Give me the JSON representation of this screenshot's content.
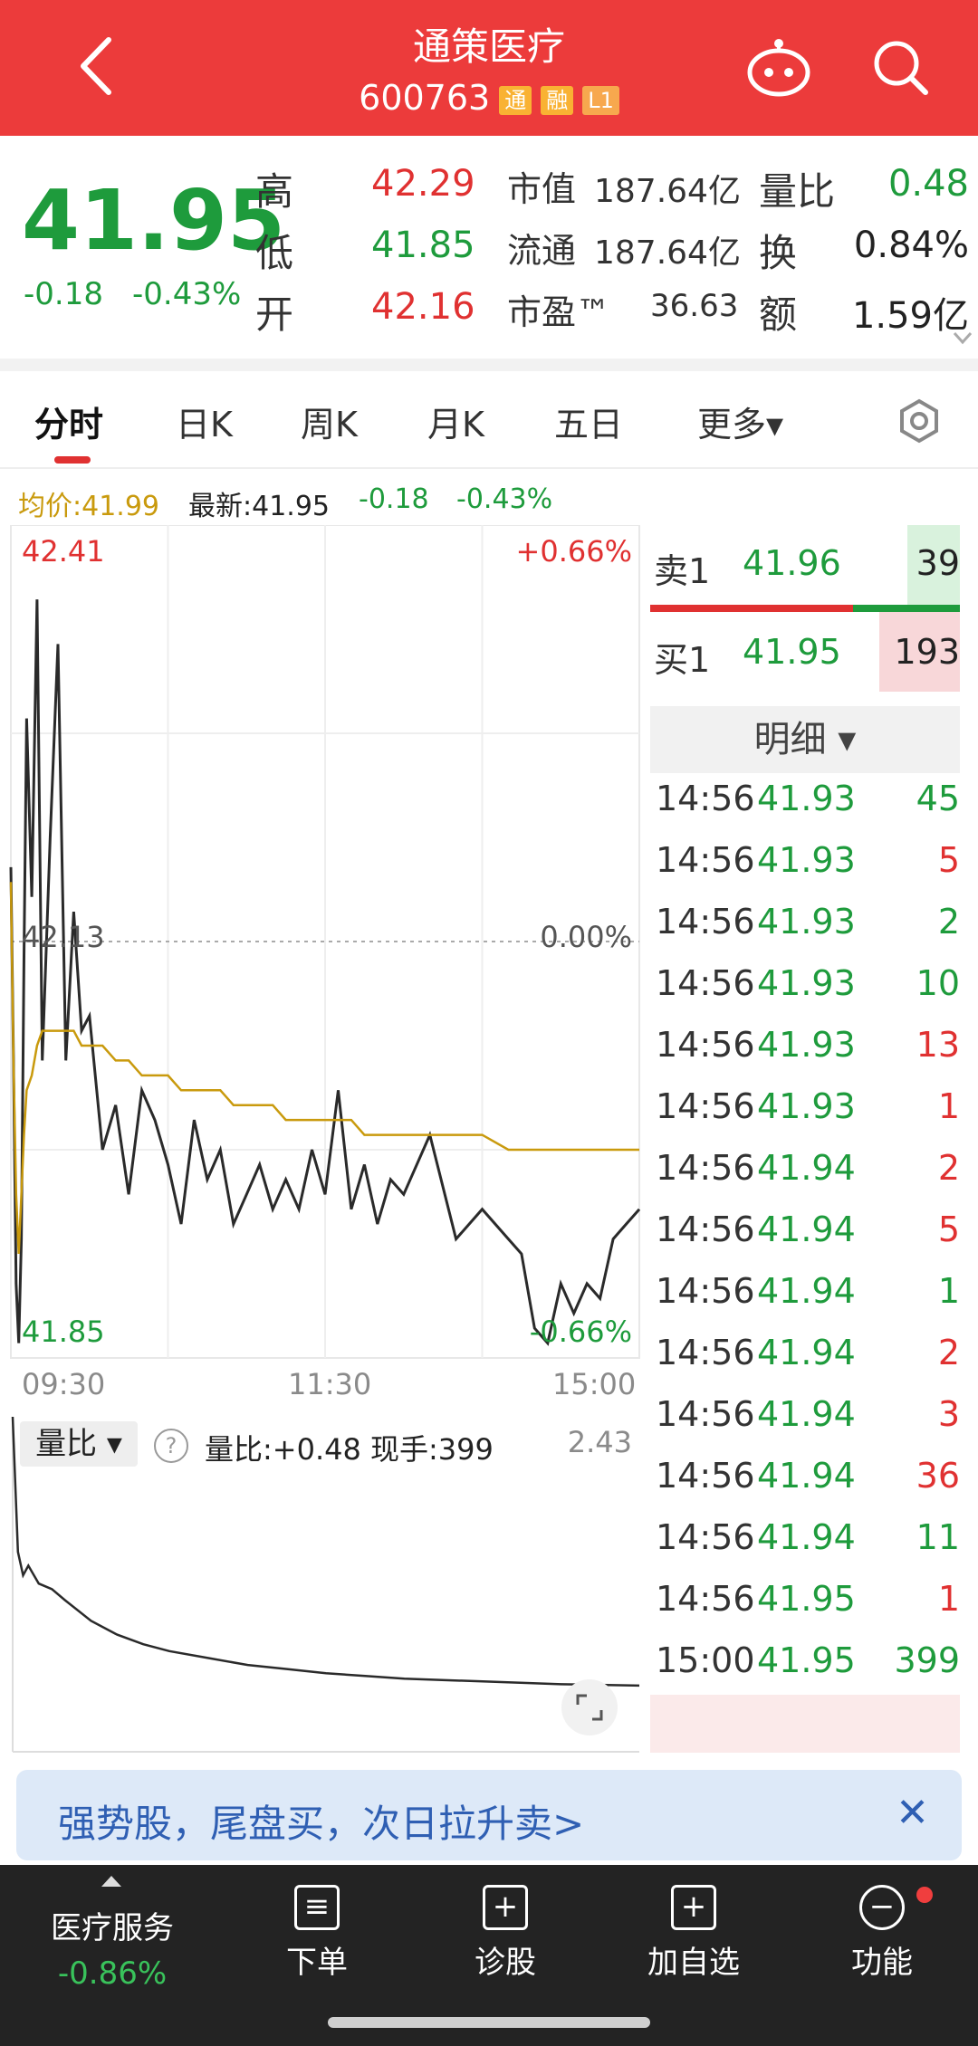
{
  "header": {
    "title": "通策医疗",
    "code": "600763",
    "tag_tong": "通",
    "tag_rong": "融",
    "tag_level": "L1"
  },
  "quote": {
    "price": "41.95",
    "change": "-0.18",
    "change_pct": "-0.43%",
    "high_label": "高",
    "high": "42.29",
    "low_label": "低",
    "low": "41.85",
    "open_label": "开",
    "open": "42.16",
    "mktcap_label": "市值",
    "mktcap": "187.64亿",
    "float_label": "流通",
    "float": "187.64亿",
    "pe_label": "市盈™",
    "pe": "36.63",
    "volratio_label": "量比",
    "volratio": "0.48",
    "turnover_label": "换",
    "turnover": "0.84%",
    "amount_label": "额",
    "amount": "1.59亿"
  },
  "tabs": [
    "分时",
    "日K",
    "周K",
    "月K",
    "五日",
    "更多▾"
  ],
  "info_bar": {
    "avg": "均价:41.99",
    "latest": "最新:41.95",
    "chg": "-0.18",
    "chg_pct": "-0.43%"
  },
  "chart_labels": {
    "top_price": "42.41",
    "top_pct": "+0.66%",
    "mid_price": "42.13",
    "mid_pct": "0.00%",
    "bot_price": "41.85",
    "bot_pct": "-0.66%",
    "x_start": "09:30",
    "x_mid": "11:30",
    "x_end": "15:00"
  },
  "chart_data": [
    {
      "type": "line",
      "x": [
        "09:30",
        "09:31",
        "09:32",
        "09:33",
        "09:34",
        "09:35",
        "09:36",
        "09:38",
        "09:40",
        "09:42",
        "09:45",
        "09:48",
        "09:51",
        "09:54",
        "09:57",
        "10:00",
        "10:05",
        "10:10",
        "10:15",
        "10:20",
        "10:25",
        "10:30",
        "10:35",
        "10:40",
        "10:45",
        "10:50",
        "10:55",
        "11:00",
        "11:05",
        "11:10",
        "11:15",
        "11:20",
        "11:25",
        "11:30",
        "13:05",
        "13:10",
        "13:15",
        "13:20",
        "13:25",
        "13:30",
        "13:40",
        "13:50",
        "14:00",
        "14:10",
        "14:15",
        "14:20",
        "14:25",
        "14:30",
        "14:35",
        "14:40",
        "14:45",
        "14:50",
        "14:55",
        "15:00"
      ],
      "series": [
        {
          "name": "最新",
          "values": [
            42.18,
            42.05,
            41.9,
            41.86,
            41.93,
            42.12,
            42.28,
            42.16,
            42.36,
            42.05,
            42.2,
            42.33,
            42.05,
            42.15,
            42.07,
            42.08,
            41.99,
            42.02,
            41.96,
            42.03,
            42.01,
            41.98,
            41.94,
            42.01,
            41.97,
            41.99,
            41.94,
            41.96,
            41.98,
            41.95,
            41.97,
            41.95,
            41.99,
            41.96,
            42.03,
            41.95,
            41.98,
            41.94,
            41.97,
            41.96,
            42.0,
            41.93,
            41.95,
            41.93,
            41.92,
            41.87,
            41.86,
            41.9,
            41.88,
            41.9,
            41.89,
            41.93,
            41.94,
            41.95
          ]
        },
        {
          "name": "均价",
          "values": [
            42.17,
            42.05,
            41.96,
            41.92,
            41.96,
            42.0,
            42.03,
            42.04,
            42.06,
            42.07,
            42.07,
            42.07,
            42.07,
            42.07,
            42.06,
            42.06,
            42.06,
            42.05,
            42.05,
            42.04,
            42.04,
            42.04,
            42.03,
            42.03,
            42.03,
            42.03,
            42.02,
            42.02,
            42.02,
            42.02,
            42.01,
            42.01,
            42.01,
            42.01,
            42.01,
            42.01,
            42.0,
            42.0,
            42.0,
            42.0,
            42.0,
            42.0,
            42.0,
            41.99,
            41.99,
            41.99,
            41.99,
            41.99,
            41.99,
            41.99,
            41.99,
            41.99,
            41.99,
            41.99
          ]
        }
      ],
      "ylim": [
        41.85,
        42.41
      ]
    },
    {
      "type": "line",
      "x": [
        "09:30",
        "09:32",
        "09:34",
        "09:36",
        "09:40",
        "09:45",
        "09:50",
        "10:00",
        "10:10",
        "10:20",
        "10:30",
        "10:45",
        "11:00",
        "11:15",
        "11:30",
        "13:15",
        "13:30",
        "14:00",
        "14:30",
        "15:00"
      ],
      "series": [
        {
          "name": "量比",
          "values": [
            2.43,
            1.45,
            1.28,
            1.35,
            1.22,
            1.18,
            1.1,
            0.95,
            0.85,
            0.78,
            0.73,
            0.68,
            0.63,
            0.6,
            0.57,
            0.55,
            0.53,
            0.51,
            0.49,
            0.48
          ]
        }
      ],
      "ylim": [
        0,
        2.43
      ]
    }
  ],
  "order_book": {
    "sell_label": "卖1",
    "sell_price": "41.96",
    "sell_vol": "39",
    "buy_label": "买1",
    "buy_price": "41.95",
    "buy_vol": "193",
    "sell_fill": 0.17,
    "buy_fill": 0.26
  },
  "detail_header": "明细 ▾",
  "trades": [
    {
      "time": "14:56",
      "price": "41.93",
      "vol": "45",
      "side": "buy"
    },
    {
      "time": "14:56",
      "price": "41.93",
      "vol": "5",
      "side": "sell"
    },
    {
      "time": "14:56",
      "price": "41.93",
      "vol": "2",
      "side": "buy"
    },
    {
      "time": "14:56",
      "price": "41.93",
      "vol": "10",
      "side": "buy"
    },
    {
      "time": "14:56",
      "price": "41.93",
      "vol": "13",
      "side": "sell"
    },
    {
      "time": "14:56",
      "price": "41.93",
      "vol": "1",
      "side": "sell"
    },
    {
      "time": "14:56",
      "price": "41.94",
      "vol": "2",
      "side": "sell"
    },
    {
      "time": "14:56",
      "price": "41.94",
      "vol": "5",
      "side": "sell"
    },
    {
      "time": "14:56",
      "price": "41.94",
      "vol": "1",
      "side": "buy"
    },
    {
      "time": "14:56",
      "price": "41.94",
      "vol": "2",
      "side": "sell"
    },
    {
      "time": "14:56",
      "price": "41.94",
      "vol": "3",
      "side": "sell"
    },
    {
      "time": "14:56",
      "price": "41.94",
      "vol": "36",
      "side": "sell"
    },
    {
      "time": "14:56",
      "price": "41.94",
      "vol": "11",
      "side": "buy"
    },
    {
      "time": "14:56",
      "price": "41.95",
      "vol": "1",
      "side": "sell"
    },
    {
      "time": "15:00",
      "price": "41.95",
      "vol": "399",
      "side": "buy"
    }
  ],
  "volume_panel": {
    "mode": "量比 ▾",
    "help": "?",
    "text": "量比:+0.48  现手:399",
    "max": "2.43"
  },
  "banner": {
    "text": "强势股，尾盘买，次日拉升卖>",
    "close": "✕"
  },
  "nav": {
    "sector_name": "医疗服务",
    "sector_chg": "-0.86%",
    "items": [
      "下单",
      "诊股",
      "加自选",
      "功能"
    ]
  },
  "colors": {
    "red": "#e03131",
    "green": "#1e9b3c",
    "gold": "#c99a0d",
    "header": "#ec3b3b"
  }
}
